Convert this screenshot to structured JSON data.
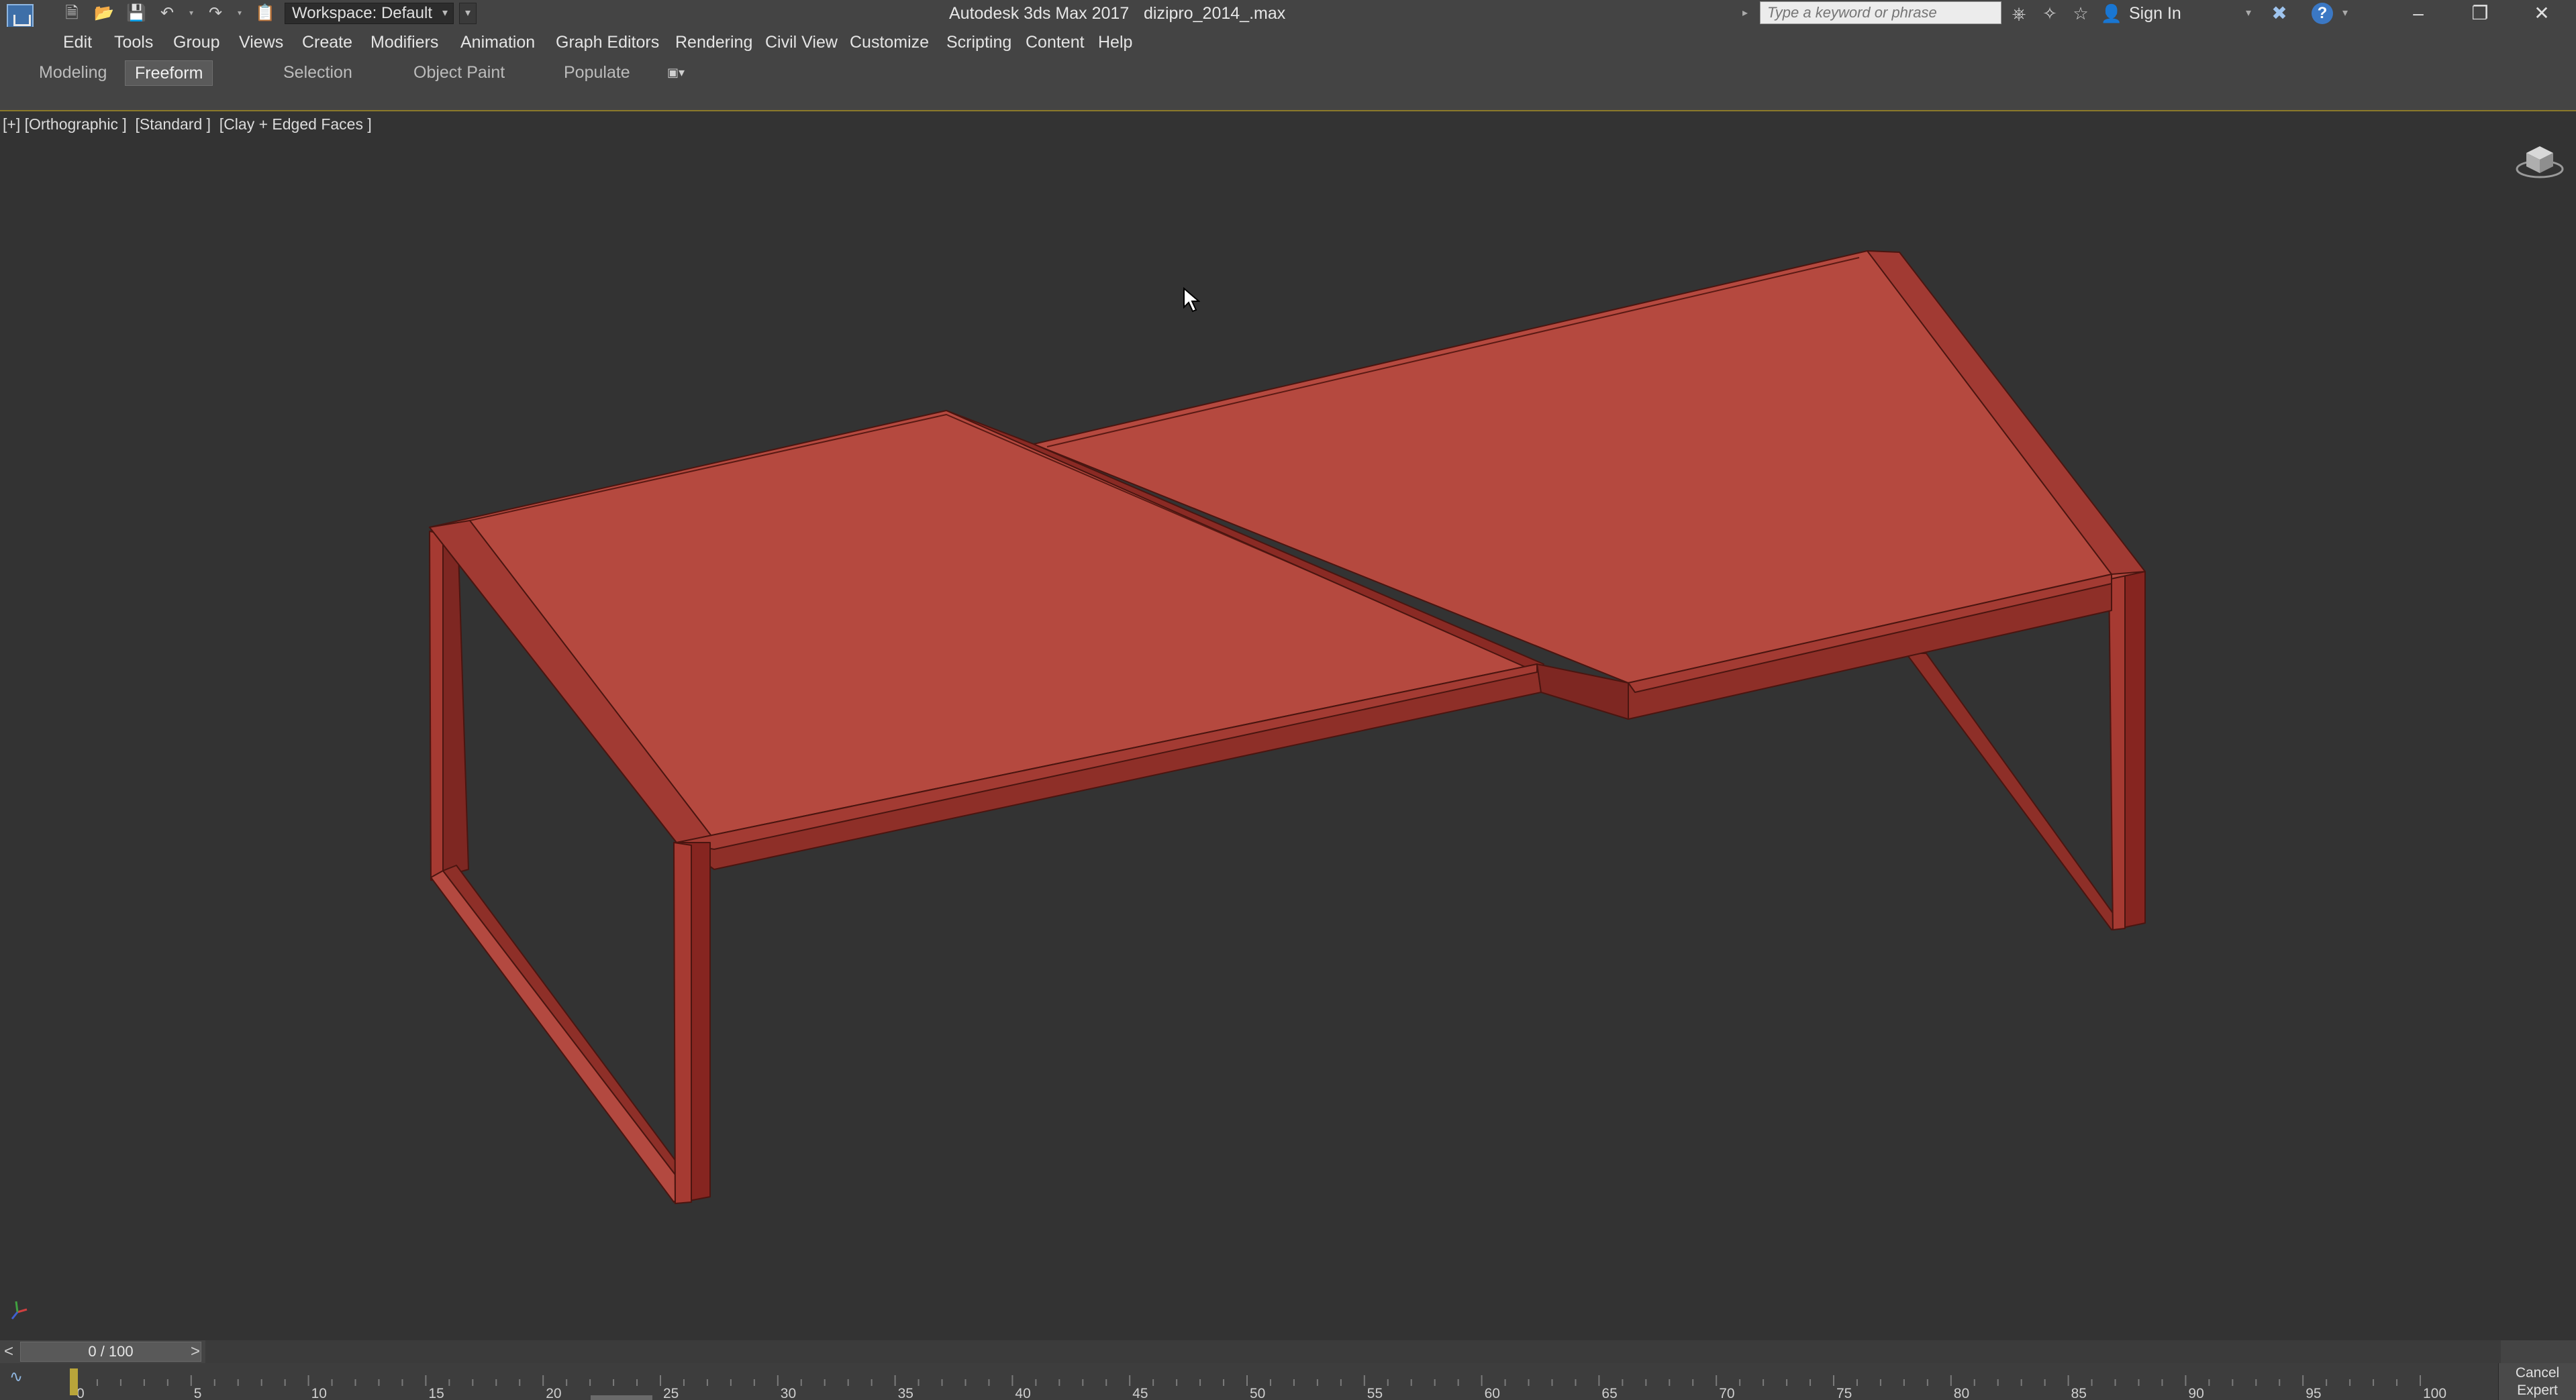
{
  "titlebar": {
    "workspace": "Workspace: Default",
    "app_title": "Autodesk 3ds Max 2017",
    "file_title": "dizipro_2014_.max",
    "search_placeholder": "Type a keyword or phrase",
    "sign_in": "Sign In",
    "help": "?"
  },
  "menu": {
    "items": [
      "Edit",
      "Tools",
      "Group",
      "Views",
      "Create",
      "Modifiers",
      "Animation",
      "Graph Editors",
      "Rendering",
      "Civil View",
      "Customize",
      "Scripting",
      "Content",
      "Help"
    ]
  },
  "ribbon": {
    "tabs": [
      "Modeling",
      "Freeform",
      "Selection",
      "Object Paint",
      "Populate"
    ],
    "active_tab": "Freeform"
  },
  "viewport": {
    "label": "[+] [Orthographic ]  [Standard ]  [Clay + Edged Faces ]",
    "model_color": "#b5493f",
    "model_edge_color": "#5a1a14",
    "model_shadow_color": "#7e2722"
  },
  "timeline": {
    "prev": "<",
    "frame": "0 / 100",
    "next": ">",
    "ticks": [
      "0",
      "5",
      "10",
      "15",
      "20",
      "25",
      "30",
      "35",
      "40",
      "45",
      "50",
      "55",
      "60",
      "65",
      "70",
      "75",
      "80",
      "85",
      "90",
      "95",
      "100"
    ],
    "cancel_line1": "Cancel",
    "cancel_line2": "Expert Mode"
  }
}
